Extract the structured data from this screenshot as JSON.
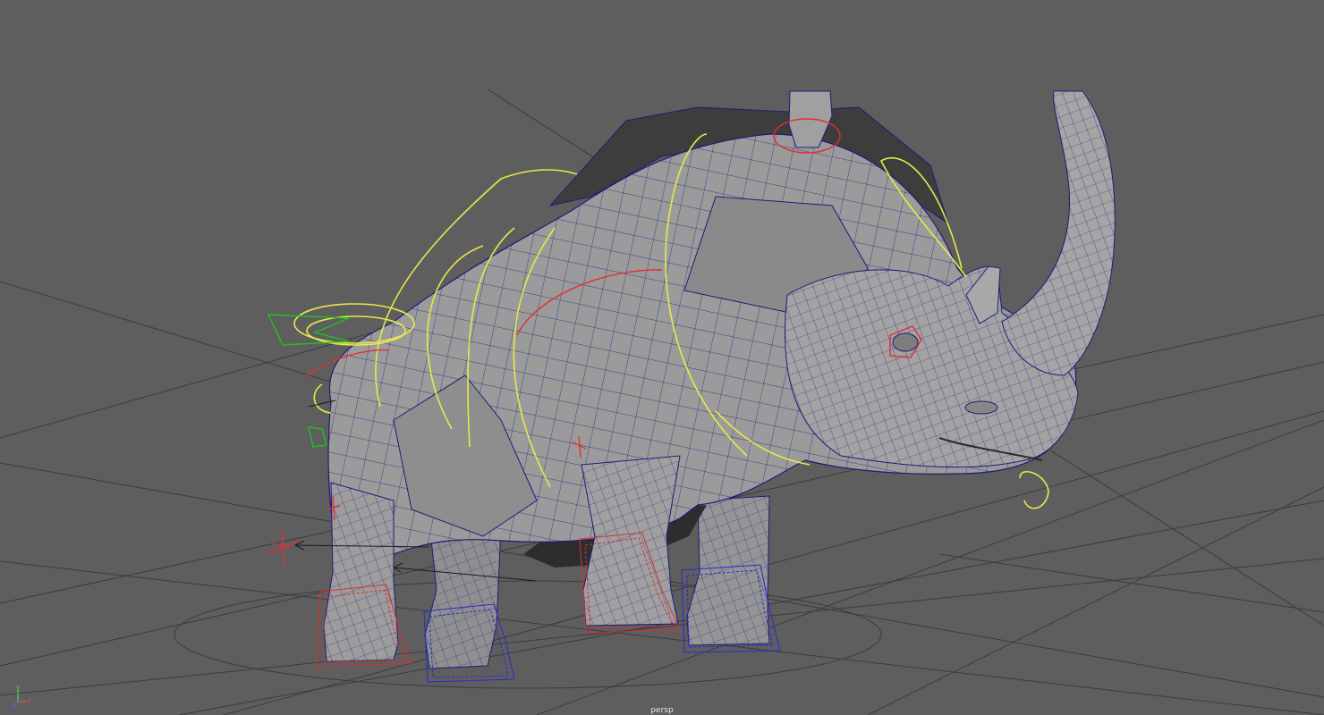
{
  "viewport": {
    "camera_name": "persp",
    "background_color": "#5e5e5e",
    "grid_color": "#3a3a3a",
    "mesh_color": "#9a9a9a",
    "wire_color": "#1c1c7a"
  },
  "axis_gizmo": {
    "x_label": "x",
    "y_label": "y",
    "z_label": "z",
    "x_color": "#e05050",
    "y_color": "#50d050",
    "z_color": "#5070f0"
  },
  "rig_controls": {
    "spine_color": "#e8e84a",
    "fk_color": "#e03030",
    "ik_foot_back_color": "#d83030",
    "ik_foot_front_color": "#2a2ad0",
    "tail_color": "#20c020"
  }
}
